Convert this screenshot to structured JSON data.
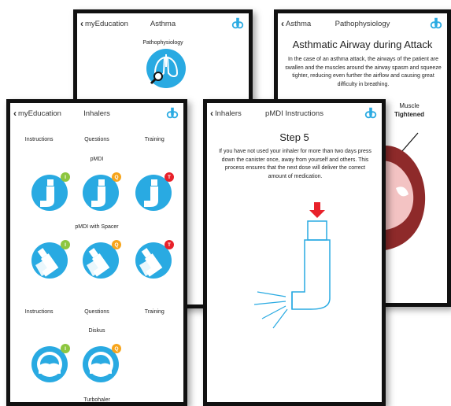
{
  "colors": {
    "accent": "#29aae2",
    "badge_instructions": "#8dc63f",
    "badge_questions": "#f7a51c",
    "badge_training": "#e8212a",
    "arrow": "#e8212a",
    "airway_wall": "#8e2a2a"
  },
  "screen_asthma": {
    "back": "myEducation",
    "title": "Asthma",
    "tile_label": "Pathophysiology",
    "tile_icon": "lungs-magnifier-icon"
  },
  "screen_patho": {
    "back": "Asthma",
    "title": "Pathophysiology",
    "heading": "Asthmatic Airway during Attack",
    "body": "In the case of an asthma attack, the airways of the patient are swallen and the muscles around the airway spasm and squeeze tighter, reducing even further the airflow and causing great difficulty in breathing.",
    "label_line1": "Muscle",
    "label_line2": "Tightened"
  },
  "screen_inhalers": {
    "back": "myEducation",
    "title": "Inhalers",
    "tabs": [
      "Instructions",
      "Questions",
      "Training"
    ],
    "section_pmdi": "pMDI",
    "section_spacer": "pMDI with Spacer",
    "tabs2": [
      "Instructions",
      "Questions",
      "Training"
    ],
    "section_diskus": "Diskus",
    "section_turbo": "Turbohaler",
    "badges": {
      "instructions": "I",
      "questions": "Q",
      "training": "T"
    }
  },
  "screen_step": {
    "back": "Inhalers",
    "title": "pMDI Instructions",
    "step": "Step 5",
    "body": "If you have not used your inhaler for more than two days press down the canister once, away from yourself and others. This process ensures that the next dose will deliver the correct amount of medication."
  }
}
